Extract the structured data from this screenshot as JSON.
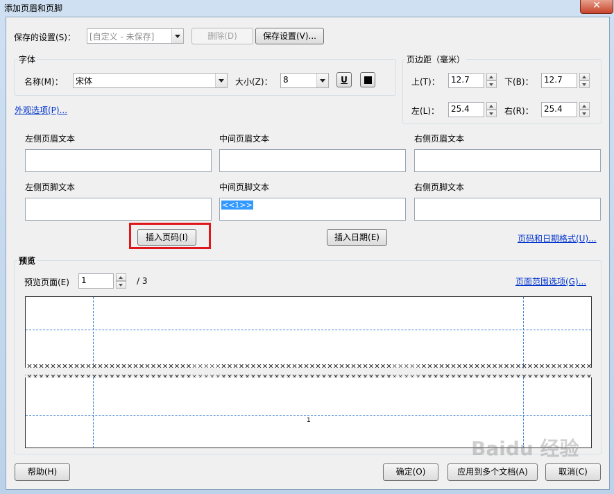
{
  "window": {
    "title": "添加页眉和页脚",
    "close_symbol": "✕"
  },
  "saved_settings": {
    "label": "保存的设置(S)：",
    "value": "[自定义 - 未保存]",
    "delete_label": "删除(D)",
    "save_label": "保存设置(V)..."
  },
  "font": {
    "group_title": "字体",
    "name_label": "名称(M)：",
    "name_value": "宋体",
    "size_label": "大小(Z)：",
    "size_value": "8",
    "underline_label": "U"
  },
  "appearance_link": "外观选项(P)...",
  "margins": {
    "group_title": "页边距（毫米）",
    "top_label": "上(T)：",
    "top_value": "12.7",
    "bottom_label": "下(B)：",
    "bottom_value": "12.7",
    "left_label": "左(L)：",
    "left_value": "25.4",
    "right_label": "右(R)：",
    "right_value": "25.4"
  },
  "header_footer": {
    "left_header": "左侧页眉文本",
    "center_header": "中间页眉文本",
    "right_header": "右侧页眉文本",
    "left_footer": "左侧页脚文本",
    "center_footer": "中间页脚文本",
    "right_footer": "右侧页脚文本",
    "center_footer_value": "<<1>>"
  },
  "insert_page_number": "插入页码(I)",
  "insert_date": "插入日期(E)",
  "page_date_format_link": "页码和日期格式(U)...",
  "preview": {
    "group_title": "预览",
    "page_label": "预览页面(E)",
    "page_value": "1",
    "page_total": "/ 3",
    "page_range_link": "页面范围选项(G)...",
    "footer_text": "1"
  },
  "bottom_buttons": {
    "help": "帮助(H)",
    "ok": "确定(O)",
    "apply_multiple": "应用到多个文档(A)",
    "cancel": "取消(C)"
  },
  "highlight_color": "#e0161b",
  "watermark": "Baidu 经验"
}
